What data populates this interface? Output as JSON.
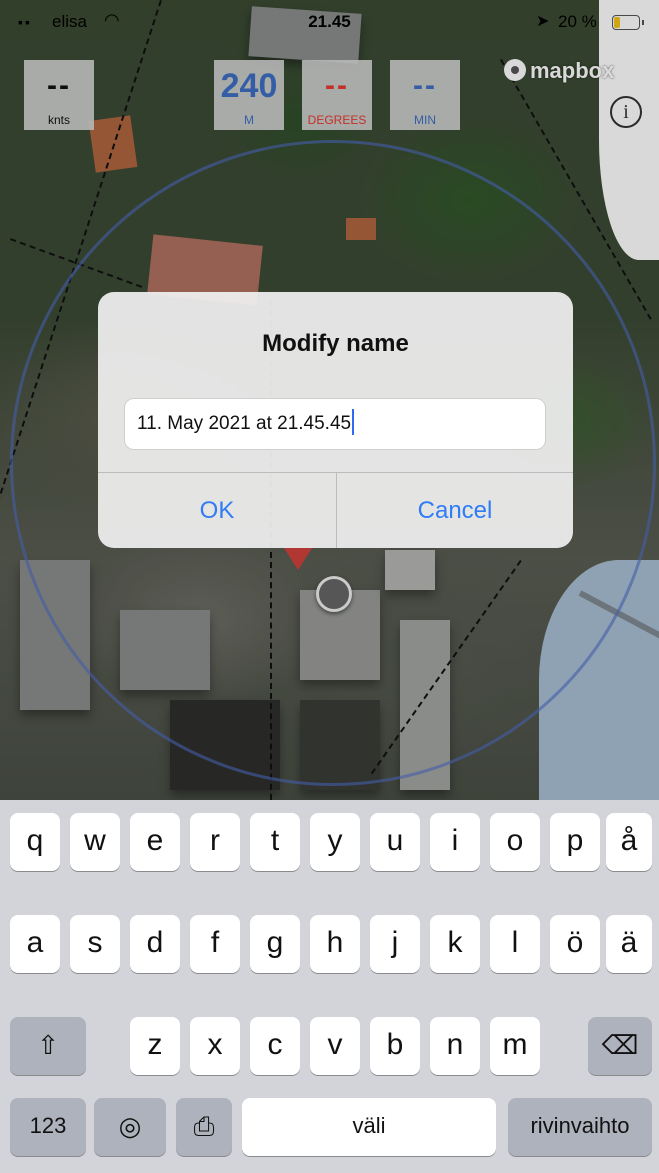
{
  "status_bar": {
    "carrier": "elisa",
    "time": "21.45",
    "battery": "20 %"
  },
  "instruments": {
    "speed": {
      "value": "--",
      "unit": "knts"
    },
    "distance": {
      "value": "240",
      "unit": "M"
    },
    "degrees": {
      "value": "--",
      "unit": "DEGREES"
    },
    "minutes": {
      "value": "--",
      "unit": "MIN"
    }
  },
  "map": {
    "attribution_logo": "mapbox",
    "info_button": "i"
  },
  "alert": {
    "title": "Modify name",
    "input_value": "11. May 2021 at 21.45.45",
    "ok_label": "OK",
    "cancel_label": "Cancel"
  },
  "keyboard": {
    "row1": [
      "q",
      "w",
      "e",
      "r",
      "t",
      "y",
      "u",
      "i",
      "o",
      "p",
      "å"
    ],
    "row2": [
      "a",
      "s",
      "d",
      "f",
      "g",
      "h",
      "j",
      "k",
      "l",
      "ö",
      "ä"
    ],
    "row3": [
      "z",
      "x",
      "c",
      "v",
      "b",
      "n",
      "m"
    ],
    "numbers_label": "123",
    "space_label": "väli",
    "return_label": "rivinvaihto"
  },
  "colors": {
    "accent_blue": "#2f7cf6",
    "distance_blue": "#3d6fc2",
    "degrees_red": "#e5392e",
    "battery_yellow": "#f2c318"
  }
}
